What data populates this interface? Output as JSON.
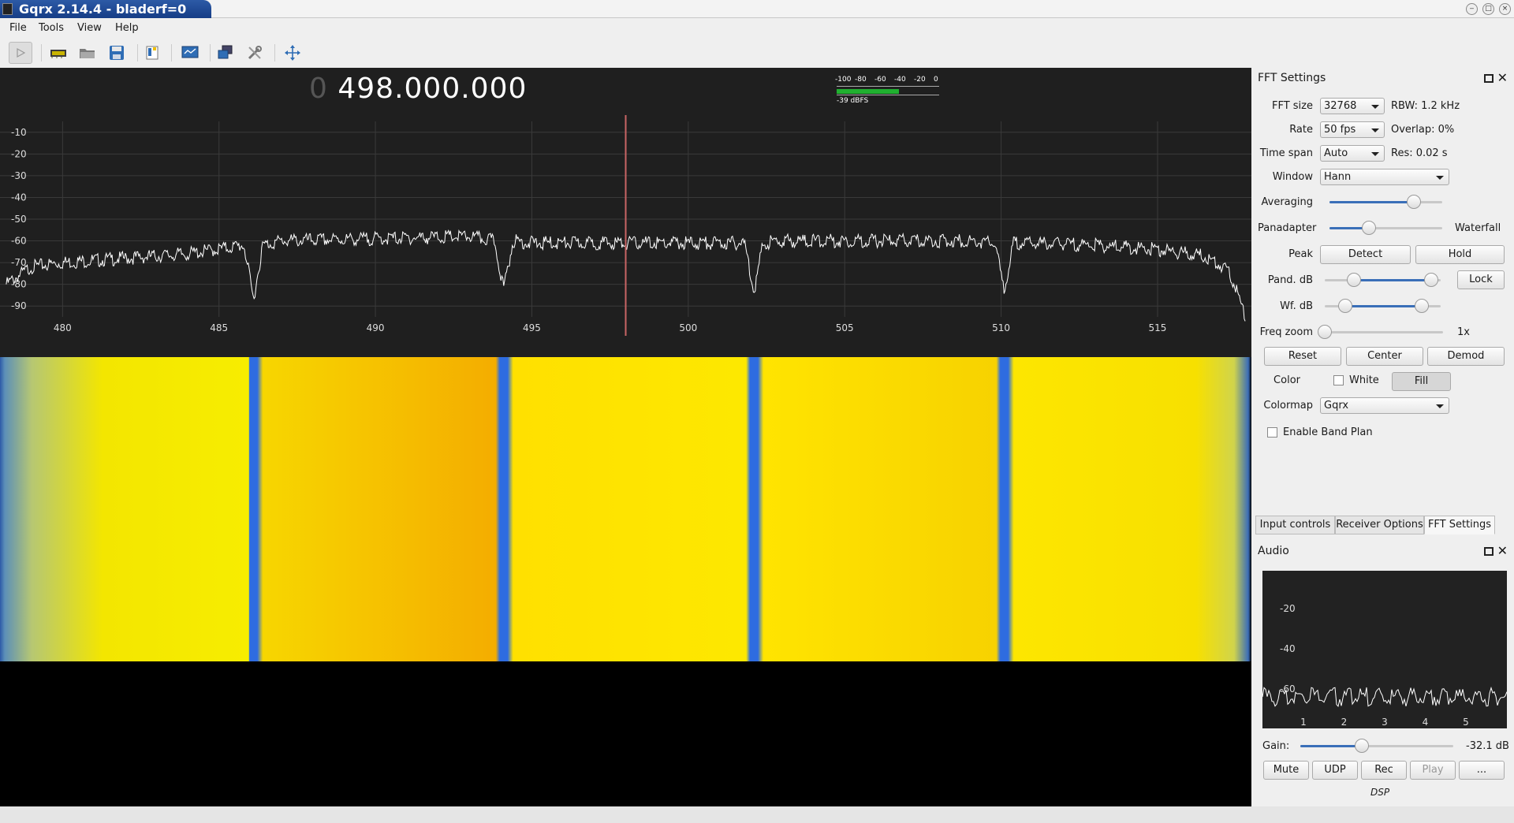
{
  "window": {
    "title": "Gqrx 2.14.4 - bladerf=0",
    "minimize": "‒",
    "maximize": "□",
    "close": "×"
  },
  "menu": {
    "file": "File",
    "tools": "Tools",
    "view": "View",
    "help": "Help"
  },
  "toolbar": {
    "icons": [
      "play-icon",
      "hardware-icon",
      "open-icon",
      "save-icon",
      "bookmark-icon",
      "remote-icon",
      "network-icon",
      "settings-icon",
      "fullscreen-icon"
    ]
  },
  "spectrum": {
    "frequency_prefix": "0",
    "frequency": "498.000.000",
    "meter_ticks": [
      "-100",
      "-80",
      "-60",
      "-40",
      "-20",
      "0"
    ],
    "meter_level_label": "-39 dBFS",
    "meter_level": -39,
    "y_ticks": [
      "-10",
      "-20",
      "-30",
      "-40",
      "-50",
      "-60",
      "-70",
      "-80",
      "-90"
    ],
    "x_ticks": [
      "480",
      "485",
      "490",
      "495",
      "500",
      "505",
      "510",
      "515"
    ],
    "colors": {
      "background": "#1f1f1f",
      "trace": "#ffffff",
      "grid": "#3a3a3a",
      "cursor": "#c86464"
    }
  },
  "chart_data": {
    "type": "line",
    "xlabel": "",
    "ylabel": "",
    "xlim": [
      478,
      518
    ],
    "ylim": [
      -95,
      -5
    ],
    "x": [
      478.2,
      479,
      480,
      482,
      484,
      485.8,
      486.1,
      486.4,
      487,
      490,
      493,
      493.8,
      494.1,
      494.4,
      495,
      498,
      501,
      501.8,
      502.1,
      502.4,
      503,
      506,
      509,
      509.8,
      510.1,
      510.4,
      511,
      513,
      515,
      516.5,
      517.3,
      517.8
    ],
    "values": [
      -80,
      -72,
      -70,
      -68,
      -66,
      -62,
      -87,
      -62,
      -60,
      -59,
      -58,
      -60,
      -82,
      -60,
      -61,
      -61,
      -61,
      -61,
      -83,
      -61,
      -60,
      -60,
      -60,
      -61,
      -83,
      -61,
      -61,
      -62,
      -64,
      -67,
      -74,
      -95
    ],
    "notches_mhz": [
      486.1,
      494.1,
      502.1,
      510.1
    ],
    "center_mhz": 498.0
  },
  "fft": {
    "title": "FFT Settings",
    "size_label": "FFT size",
    "size": "32768",
    "rbw": "RBW: 1.2 kHz",
    "rate_label": "Rate",
    "rate": "50 fps",
    "overlap": "Overlap: 0%",
    "timespan_label": "Time span",
    "timespan": "Auto",
    "res": "Res: 0.02 s",
    "window_label": "Window",
    "window": "Hann",
    "averaging_label": "Averaging",
    "averaging": 0.75,
    "panadapter_label": "Panadapter",
    "panadapter": 0.35,
    "waterfall_label": "Waterfall",
    "peak_label": "Peak",
    "detect": "Detect",
    "hold": "Hold",
    "pand_db_label": "Pand. dB",
    "pand_db_low": 0.25,
    "pand_db_high": 0.92,
    "lock": "Lock",
    "wf_db_label": "Wf. dB",
    "wf_db_low": 0.18,
    "wf_db_high": 0.84,
    "freq_zoom_label": "Freq zoom",
    "freq_zoom": 0.0,
    "freq_zoom_value": "1x",
    "reset": "Reset",
    "center": "Center",
    "demod": "Demod",
    "color_label": "Color",
    "white": "White",
    "fill": "Fill",
    "colormap_label": "Colormap",
    "colormap": "Gqrx",
    "bandplan": "Enable Band Plan"
  },
  "tabs": {
    "input": "Input controls",
    "receiver": "Receiver Options",
    "fft": "FFT Settings"
  },
  "audio": {
    "title": "Audio",
    "y_ticks": [
      "-20",
      "-40",
      "-60"
    ],
    "x_ticks": [
      "1",
      "2",
      "3",
      "4",
      "5"
    ],
    "gain_label": "Gain:",
    "gain": 0.4,
    "gain_value": "-32.1 dB",
    "mute": "Mute",
    "udp": "UDP",
    "rec": "Rec",
    "play": "Play",
    "more": "...",
    "dsp": "DSP"
  }
}
